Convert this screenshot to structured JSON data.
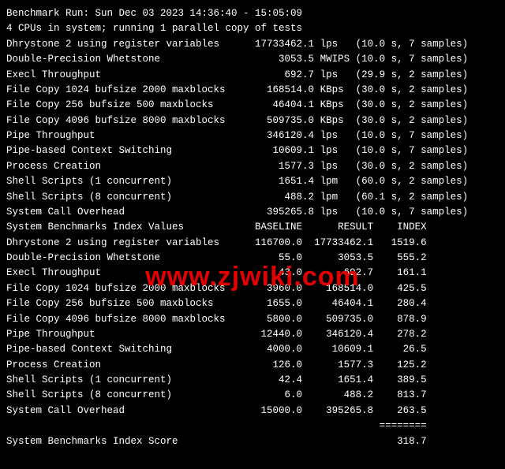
{
  "header": {
    "run_line": "Benchmark Run: Sun Dec 03 2023 14:36:40 - 15:05:09",
    "cpu_line": "4 CPUs in system; running 1 parallel copy of tests"
  },
  "tests": [
    {
      "name": "Dhrystone 2 using register variables",
      "value": "17733462.1",
      "unit": "lps",
      "time": "10.0",
      "samples": "7"
    },
    {
      "name": "Double-Precision Whetstone",
      "value": "3053.5",
      "unit": "MWIPS",
      "time": "10.0",
      "samples": "7"
    },
    {
      "name": "Execl Throughput",
      "value": "692.7",
      "unit": "lps",
      "time": "29.9",
      "samples": "2"
    },
    {
      "name": "File Copy 1024 bufsize 2000 maxblocks",
      "value": "168514.0",
      "unit": "KBps",
      "time": "30.0",
      "samples": "2"
    },
    {
      "name": "File Copy 256 bufsize 500 maxblocks",
      "value": "46404.1",
      "unit": "KBps",
      "time": "30.0",
      "samples": "2"
    },
    {
      "name": "File Copy 4096 bufsize 8000 maxblocks",
      "value": "509735.0",
      "unit": "KBps",
      "time": "30.0",
      "samples": "2"
    },
    {
      "name": "Pipe Throughput",
      "value": "346120.4",
      "unit": "lps",
      "time": "10.0",
      "samples": "7"
    },
    {
      "name": "Pipe-based Context Switching",
      "value": "10609.1",
      "unit": "lps",
      "time": "10.0",
      "samples": "7"
    },
    {
      "name": "Process Creation",
      "value": "1577.3",
      "unit": "lps",
      "time": "30.0",
      "samples": "2"
    },
    {
      "name": "Shell Scripts (1 concurrent)",
      "value": "1651.4",
      "unit": "lpm",
      "time": "60.0",
      "samples": "2"
    },
    {
      "name": "Shell Scripts (8 concurrent)",
      "value": "488.2",
      "unit": "lpm",
      "time": "60.1",
      "samples": "2"
    },
    {
      "name": "System Call Overhead",
      "value": "395265.8",
      "unit": "lps",
      "time": "10.0",
      "samples": "7"
    }
  ],
  "index_header": {
    "title": "System Benchmarks Index Values",
    "col_baseline": "BASELINE",
    "col_result": "RESULT",
    "col_index": "INDEX"
  },
  "index": [
    {
      "name": "Dhrystone 2 using register variables",
      "baseline": "116700.0",
      "result": "17733462.1",
      "index": "1519.6"
    },
    {
      "name": "Double-Precision Whetstone",
      "baseline": "55.0",
      "result": "3053.5",
      "index": "555.2"
    },
    {
      "name": "Execl Throughput",
      "baseline": "43.0",
      "result": "692.7",
      "index": "161.1"
    },
    {
      "name": "File Copy 1024 bufsize 2000 maxblocks",
      "baseline": "3960.0",
      "result": "168514.0",
      "index": "425.5"
    },
    {
      "name": "File Copy 256 bufsize 500 maxblocks",
      "baseline": "1655.0",
      "result": "46404.1",
      "index": "280.4"
    },
    {
      "name": "File Copy 4096 bufsize 8000 maxblocks",
      "baseline": "5800.0",
      "result": "509735.0",
      "index": "878.9"
    },
    {
      "name": "Pipe Throughput",
      "baseline": "12440.0",
      "result": "346120.4",
      "index": "278.2"
    },
    {
      "name": "Pipe-based Context Switching",
      "baseline": "4000.0",
      "result": "10609.1",
      "index": "26.5"
    },
    {
      "name": "Process Creation",
      "baseline": "126.0",
      "result": "1577.3",
      "index": "125.2"
    },
    {
      "name": "Shell Scripts (1 concurrent)",
      "baseline": "42.4",
      "result": "1651.4",
      "index": "389.5"
    },
    {
      "name": "Shell Scripts (8 concurrent)",
      "baseline": "6.0",
      "result": "488.2",
      "index": "813.7"
    },
    {
      "name": "System Call Overhead",
      "baseline": "15000.0",
      "result": "395265.8",
      "index": "263.5"
    }
  ],
  "score": {
    "sep": "========",
    "label": "System Benchmarks Index Score",
    "value": "318.7"
  },
  "watermark": "www.zjwiki.com"
}
